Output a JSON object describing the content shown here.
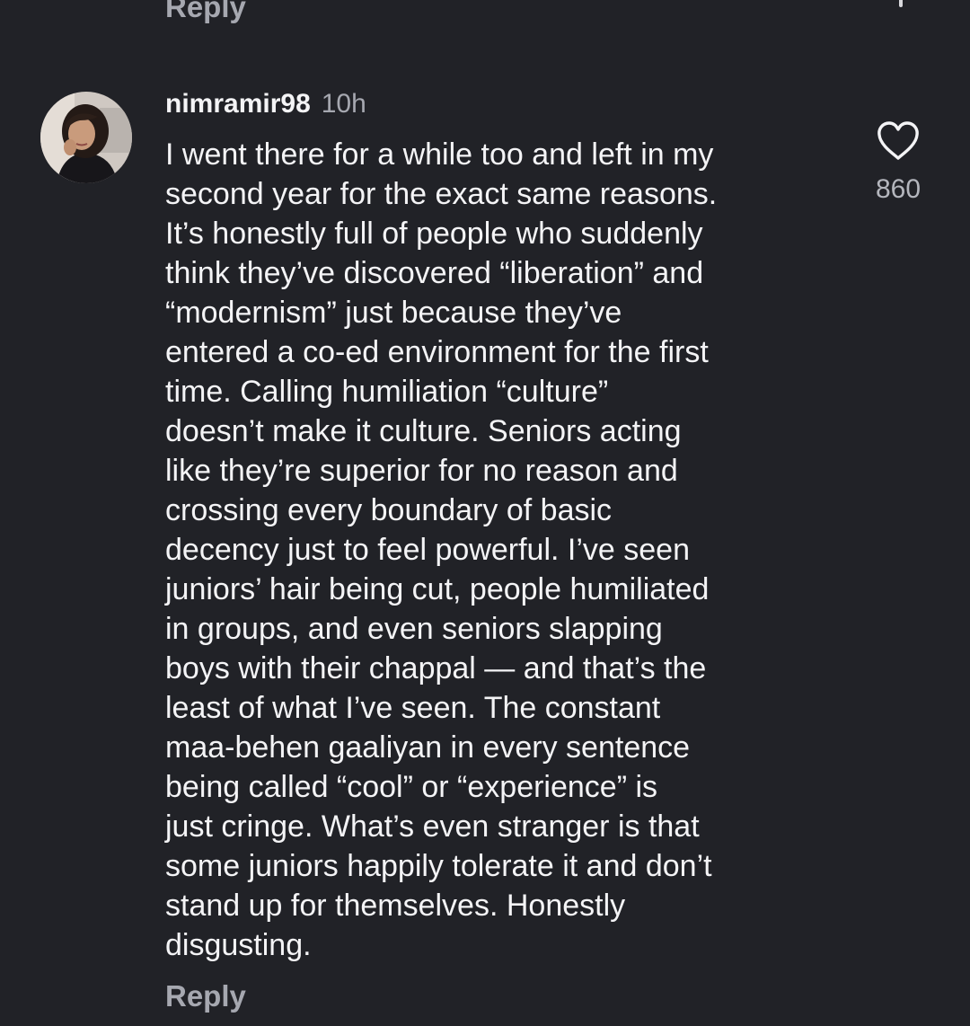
{
  "previous_comment": {
    "reply_label": "Reply"
  },
  "comment": {
    "username": "nimramir98",
    "time_ago": "10h",
    "avatar_icon": "user-avatar-photo",
    "lines": [
      "I went there for a while too and left in my",
      "second year for the exact same reasons.",
      "It’s honestly full of people who suddenly",
      "think they’ve discovered “liberation” and",
      "“modernism” just because they’ve",
      "entered a co-ed environment for the first",
      "time. Calling humiliation “culture”",
      "doesn’t make it culture. Seniors acting",
      "like they’re superior for no reason and",
      "crossing every boundary of basic",
      "decency just to feel powerful. I’ve seen",
      "juniors’ hair being cut, people humiliated",
      "in groups, and even seniors slapping",
      "boys with their chappal — and that’s the",
      "least of what I’ve seen. The constant",
      "maa-behen gaaliyan in every sentence",
      "being called “cool” or “experience” is",
      "just cringe. What’s even stranger is that",
      "some juniors happily tolerate it and don’t",
      "stand up for themselves. Honestly",
      "disgusting."
    ],
    "like_icon": "heart-outline-icon",
    "like_count": "860",
    "reply_label": "Reply"
  },
  "colors": {
    "background": "#212227",
    "primary_text": "#f4f4f6",
    "secondary_text": "#a6a8b0"
  }
}
